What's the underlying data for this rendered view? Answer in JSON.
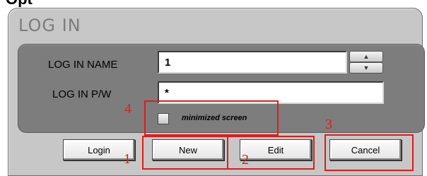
{
  "top_fragment": "Opt",
  "dialog": {
    "title": "LOG IN",
    "name_label": "LOG IN NAME",
    "name_value": "1",
    "pw_label": "LOG IN P/W",
    "pw_value": "*",
    "checkbox_label": "minimized screen",
    "checkbox_checked": false
  },
  "buttons": {
    "login": "Login",
    "new": "New",
    "edit": "Edit",
    "cancel": "Cancel"
  },
  "annotations": {
    "n1": "1",
    "n2": "2",
    "n3": "3",
    "n4": "4",
    "color": "#e21b1b"
  },
  "colors": {
    "dialog_bg": "#c7c7c7",
    "inner_panel": "#7d7d7d"
  }
}
